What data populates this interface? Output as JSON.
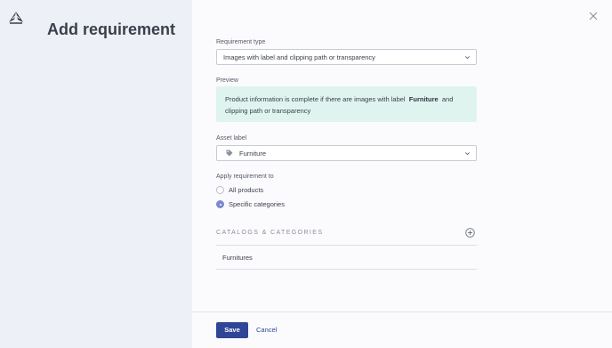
{
  "page": {
    "title": "Add requirement"
  },
  "form": {
    "requirement_type": {
      "label": "Requirement type",
      "value": "Images with label and clipping path or transparency"
    },
    "preview": {
      "label": "Preview",
      "text_before": "Product information is complete if there are images with label",
      "highlight": "Furniture",
      "text_after": "and clipping path or transparency"
    },
    "asset_label": {
      "label": "Asset label",
      "value": "Furniture"
    },
    "apply_to": {
      "label": "Apply requirement to",
      "options": [
        {
          "label": "All products",
          "checked": false
        },
        {
          "label": "Specific categories",
          "checked": true
        }
      ]
    },
    "catalogs": {
      "title": "CATALOGS & CATEGORIES",
      "items": [
        "Furnitures"
      ]
    }
  },
  "footer": {
    "save_label": "Save",
    "cancel_label": "Cancel"
  },
  "colors": {
    "primary": "#2f4696",
    "preview_bg": "#dff4ee",
    "side_panel": "#eef0f7",
    "radio_checked": "#7b88cf"
  },
  "icons": [
    "app-logo-icon",
    "close-icon",
    "chevron-down-icon",
    "tag-icon",
    "add-circle-icon"
  ]
}
